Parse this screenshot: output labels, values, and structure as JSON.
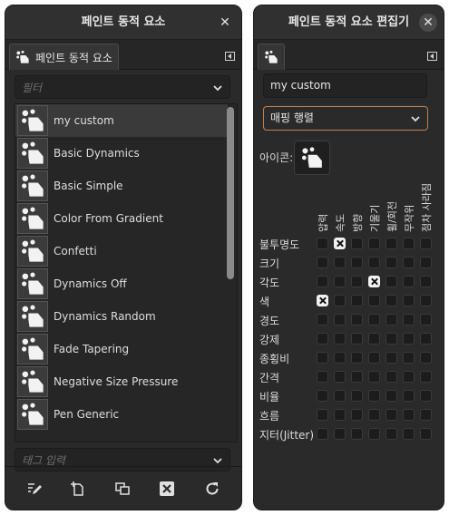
{
  "left_dialog": {
    "title": "페인트 동적 요소",
    "tab_label": "페인트 동적 요소",
    "filter_placeholder": "필터",
    "tag_placeholder": "태그 입력",
    "items": [
      {
        "label": "my custom",
        "selected": true
      },
      {
        "label": "Basic Dynamics",
        "selected": false
      },
      {
        "label": "Basic Simple",
        "selected": false
      },
      {
        "label": "Color From Gradient",
        "selected": false
      },
      {
        "label": "Confetti",
        "selected": false
      },
      {
        "label": "Dynamics Off",
        "selected": false
      },
      {
        "label": "Dynamics Random",
        "selected": false
      },
      {
        "label": "Fade Tapering",
        "selected": false
      },
      {
        "label": "Negative Size Pressure",
        "selected": false
      },
      {
        "label": "Pen Generic",
        "selected": false
      }
    ],
    "scroll_position": 0.0,
    "toolbar_icons": [
      "edit-icon",
      "new-icon",
      "duplicate-icon",
      "delete-icon",
      "refresh-icon"
    ]
  },
  "right_dialog": {
    "title": "페인트 동적 요소 편집기",
    "name_value": "my custom",
    "mode_value": "매핑 행렬",
    "icon_label": "아이콘:",
    "columns": [
      "압력",
      "속도",
      "방향",
      "기울기",
      "휠/회전",
      "무작위",
      "점차 사라짐"
    ],
    "rows": [
      "불투명도",
      "크기",
      "각도",
      "색",
      "경도",
      "강제",
      "종횡비",
      "간격",
      "비율",
      "흐름",
      "지터(Jitter)"
    ],
    "checked": [
      [
        0,
        1
      ],
      [
        2,
        3
      ],
      [
        3,
        0
      ]
    ]
  },
  "colors": {
    "background": "#2a2a2a",
    "accent_border": "#c08050",
    "checked": "#f2f2f2"
  }
}
